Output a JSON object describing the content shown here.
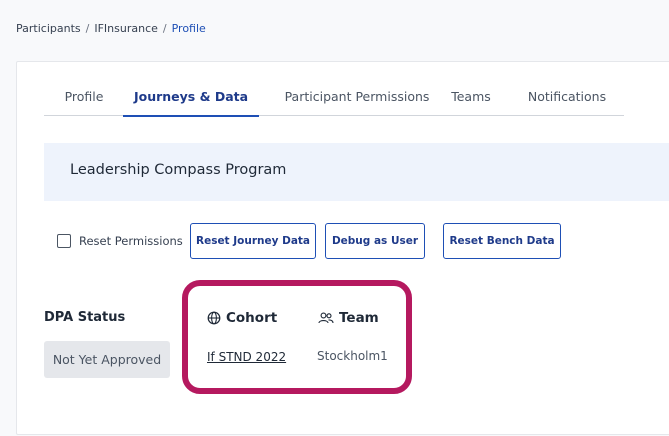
{
  "breadcrumb": {
    "items": [
      "Participants",
      "IFInsurance",
      "Profile"
    ],
    "separator": "/"
  },
  "tabs": [
    {
      "label": "Profile",
      "active": false
    },
    {
      "label": "Journeys & Data",
      "active": true
    },
    {
      "label": "Participant Permissions",
      "active": false
    },
    {
      "label": "Teams",
      "active": false
    },
    {
      "label": "Notifications",
      "active": false
    }
  ],
  "program": {
    "title": "Leadership Compass Program"
  },
  "actions": {
    "reset_permissions_label": "Reset Permissions",
    "reset_permissions_checked": false,
    "reset_journey_label": "Reset Journey Data",
    "debug_label": "Debug as User",
    "reset_bench_label": "Reset Bench Data"
  },
  "dpa": {
    "label": "DPA Status",
    "status": "Not Yet Approved"
  },
  "cohort": {
    "label": "Cohort",
    "icon": "globe-icon",
    "value": "If STND 2022"
  },
  "team": {
    "label": "Team",
    "icon": "people-icon",
    "value": "Stockholm1"
  },
  "colors": {
    "accent": "#1e4fb5",
    "highlight": "#b5195f",
    "banner_bg": "#eef3fc",
    "badge_bg": "#e5e7eb"
  }
}
